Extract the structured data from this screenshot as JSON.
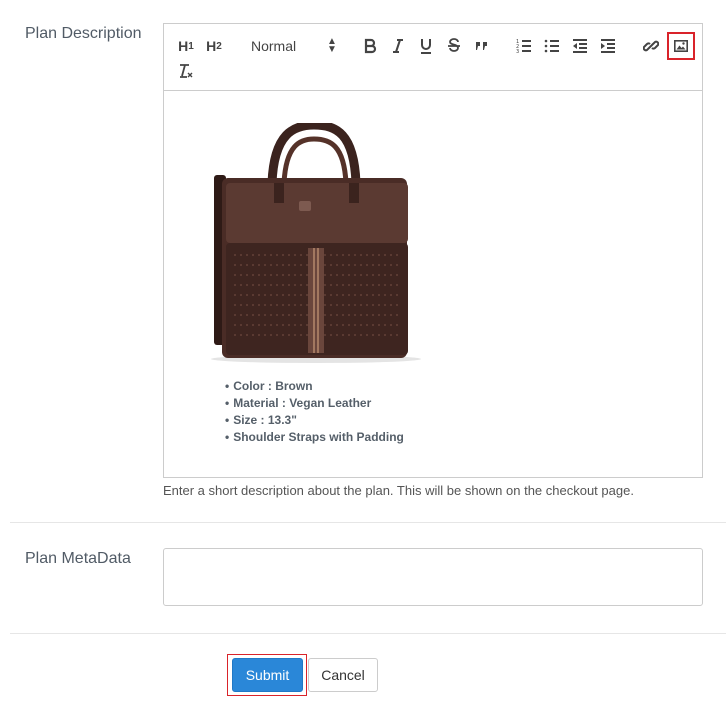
{
  "form": {
    "description_label": "Plan Description",
    "metadata_label": "Plan MetaData",
    "help_text": "Enter a short description about the plan. This will be shown on the checkout page.",
    "metadata_value": ""
  },
  "toolbar": {
    "h1": "H",
    "h1_sub": "1",
    "h2": "H",
    "h2_sub": "2",
    "format_select": "Normal",
    "icons": [
      "bold-icon",
      "italic-icon",
      "underline-icon",
      "strike-icon",
      "blockquote-icon",
      "ordered-list-icon",
      "bullet-list-icon",
      "outdent-icon",
      "indent-icon",
      "link-icon",
      "image-icon",
      "clear-format-icon"
    ]
  },
  "content": {
    "features": [
      "Color : Brown",
      "Material : Vegan Leather",
      "Size : 13.3\"",
      "Shoulder Straps with Padding"
    ]
  },
  "actions": {
    "submit": "Submit",
    "cancel": "Cancel"
  },
  "colors": {
    "primary": "#2a87d8",
    "highlight": "#d9232a",
    "bag": "#4e2f28"
  }
}
